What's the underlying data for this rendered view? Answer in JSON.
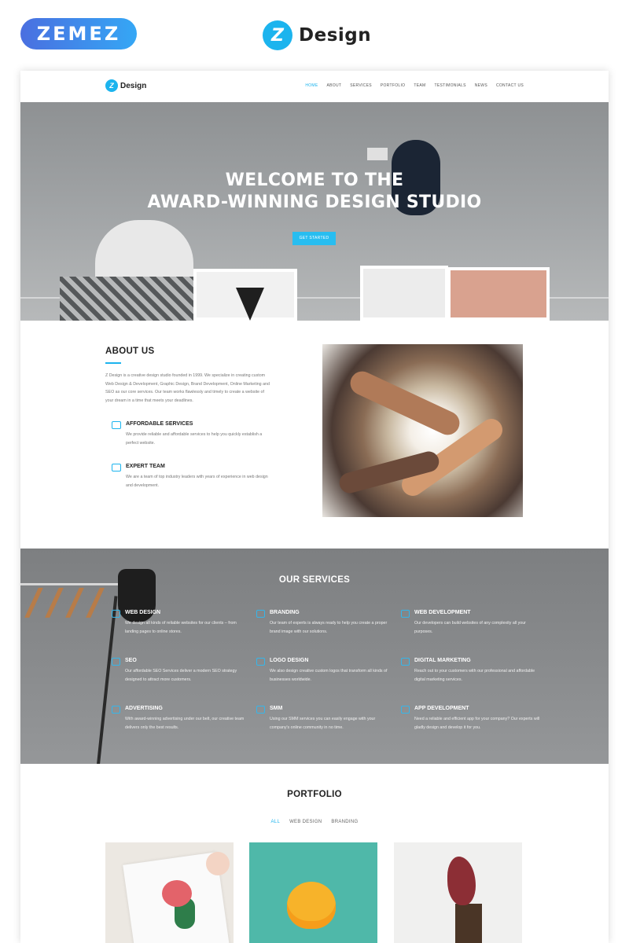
{
  "vendor_logo": {
    "text": "ZEMEZ"
  },
  "brand": {
    "letter": "Z",
    "name": "Design"
  },
  "nav": {
    "logo_letter": "Z",
    "logo_name": "Design",
    "items": [
      "HOME",
      "ABOUT",
      "SERVICES",
      "PORTFOLIO",
      "TEAM",
      "TESTIMONIALS",
      "NEWS",
      "CONTACT US"
    ]
  },
  "hero": {
    "line1": "WELCOME TO THE",
    "line2": "AWARD-WINNING DESIGN STUDIO",
    "button": "GET STARTED"
  },
  "about": {
    "title": "ABOUT US",
    "description": "Z Design is a creative design studio founded in 1999. We specialize in creating custom Web Design & Development, Graphic Design, Brand Development, Online Marketing and SEO as our core services. Our team works flawlessly and timely to create a website of your dream in a time that meets your deadlines.",
    "features": [
      {
        "title": "AFFORDABLE SERVICES",
        "text": "We provide reliable and affordable services to help you quickly establish a perfect website.",
        "icon": "affordable-icon"
      },
      {
        "title": "EXPERT TEAM",
        "text": "We are a team of top industry leaders with years of experience in web design and development.",
        "icon": "team-icon"
      }
    ]
  },
  "services": {
    "title": "OUR SERVICES",
    "items": [
      {
        "title": "WEB DESIGN",
        "text": "We design all kinds of reliable websites for our clients – from landing pages to online stores.",
        "icon": "web-design-icon"
      },
      {
        "title": "BRANDING",
        "text": "Our team of experts is always ready to help you create a proper brand image with our solutions.",
        "icon": "branding-icon"
      },
      {
        "title": "WEB DEVELOPMENT",
        "text": "Our developers can build websites of any complexity all your purposes.",
        "icon": "web-development-icon"
      },
      {
        "title": "SEO",
        "text": "Our affordable SEO Services deliver a modern SEO strategy designed to attract more customers.",
        "icon": "seo-icon"
      },
      {
        "title": "LOGO DESIGN",
        "text": "We also design creative custom logos that transform all kinds of businesses worldwide.",
        "icon": "logo-design-icon"
      },
      {
        "title": "DIGITAL MARKETING",
        "text": "Reach out to your customers with our professional and affordable digital marketing services.",
        "icon": "digital-marketing-icon"
      },
      {
        "title": "ADVERTISING",
        "text": "With award-winning advertising under our belt, our creative team delivers only the best results.",
        "icon": "advertising-icon"
      },
      {
        "title": "SMM",
        "text": "Using our SMM services you can easily engage with your company's online community in no time.",
        "icon": "smm-icon"
      },
      {
        "title": "APP DEVELOPMENT",
        "text": "Need a reliable and efficient app for your company? Our experts will gladly design and develop it for you.",
        "icon": "app-development-icon"
      }
    ]
  },
  "portfolio": {
    "title": "PORTFOLIO",
    "filters": [
      "ALL",
      "WEB DESIGN",
      "BRANDING"
    ]
  },
  "colors": {
    "accent": "#1cb4ee",
    "button": "#28bdf0"
  }
}
